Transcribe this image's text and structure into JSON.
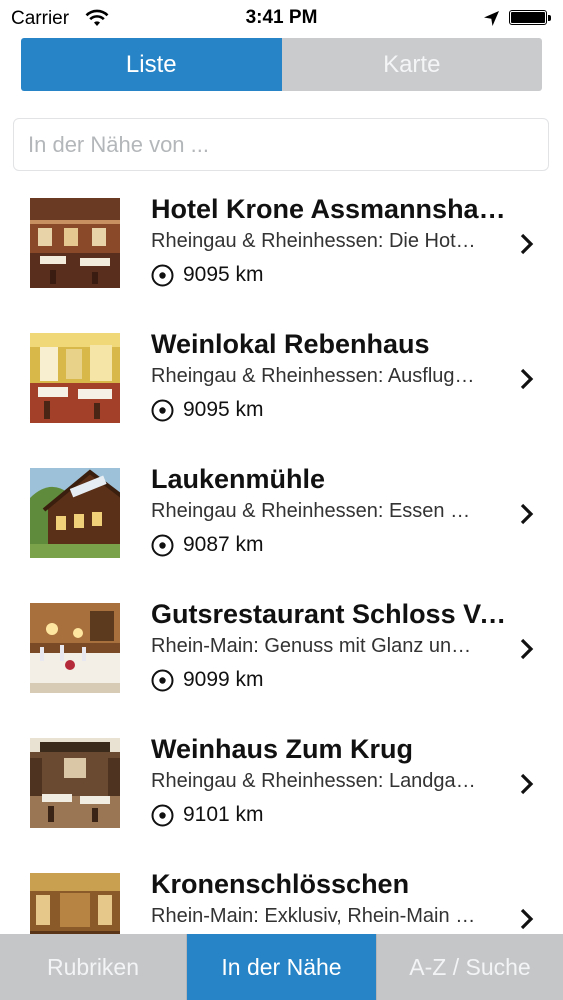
{
  "status_bar": {
    "carrier": "Carrier",
    "time": "3:41 PM",
    "icons": [
      "wifi-icon",
      "location-arrow-icon",
      "battery-icon"
    ]
  },
  "segmented": {
    "items": [
      {
        "label": "Liste",
        "active": true
      },
      {
        "label": "Karte",
        "active": false
      }
    ]
  },
  "search": {
    "placeholder": "In der Nähe von ...",
    "value": ""
  },
  "list": {
    "items": [
      {
        "title": "Hotel Krone Assmannshausen",
        "subtitle": "Rheingau & Rheinhessen: Die Hotel Krone",
        "distance": "9095 km"
      },
      {
        "title": "Weinlokal Rebenhaus",
        "subtitle": "Rheingau & Rheinhessen: Ausflugslokal",
        "distance": "9095 km"
      },
      {
        "title": "Laukenmühle",
        "subtitle": "Rheingau & Rheinhessen: Essen und Trinken",
        "distance": "9087 km"
      },
      {
        "title": "Gutsrestaurant Schloss Vollrads",
        "subtitle": "Rhein-Main: Genuss mit Glanz und Stil",
        "distance": "9099 km"
      },
      {
        "title": "Weinhaus Zum Krug",
        "subtitle": "Rheingau & Rheinhessen: Landgasthaus",
        "distance": "9101 km"
      },
      {
        "title": "Kronenschlösschen",
        "subtitle": "Rhein-Main: Exklusiv, Rhein-Main Region",
        "distance": ""
      }
    ]
  },
  "tabbar": {
    "items": [
      {
        "label": "Rubriken",
        "active": false
      },
      {
        "label": "In der Nähe",
        "active": true
      },
      {
        "label": "A-Z / Suche",
        "active": false
      }
    ]
  },
  "colors": {
    "accent": "#2784c6",
    "inactive_segment": "#c9cbcd",
    "tabbar_inactive": "#c4c6c8"
  }
}
